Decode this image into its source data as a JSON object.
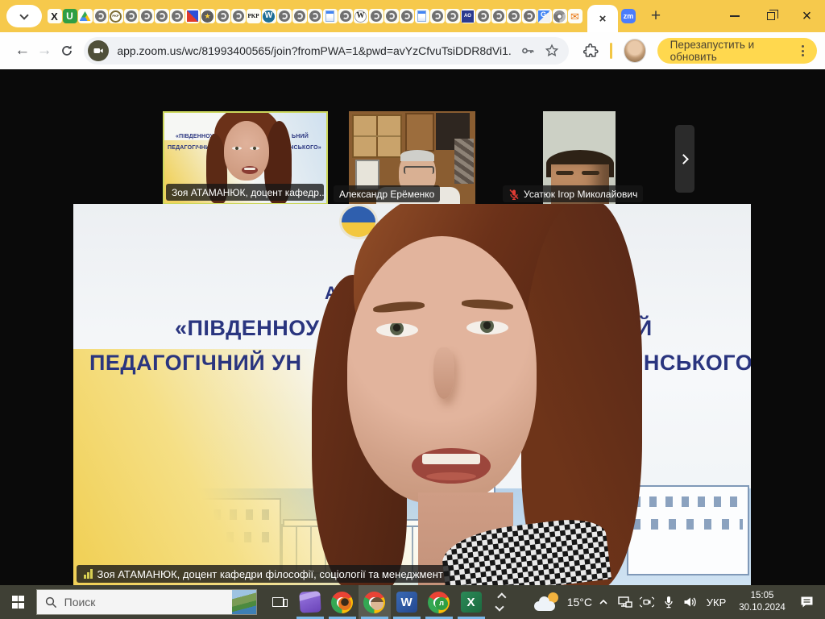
{
  "browser": {
    "tab_strip": {
      "tabs": [
        "joomla",
        "u",
        "drive",
        "spin",
        "pkp-round",
        "spin",
        "spin",
        "spin",
        "spin",
        "flag",
        "star",
        "spin",
        "spin",
        "pkp",
        "wordpress",
        "spin",
        "spin",
        "spin",
        "doc",
        "spin",
        "wiki",
        "spin",
        "spin",
        "spin",
        "doc",
        "spin",
        "spin",
        "ao",
        "spin",
        "spin",
        "spin",
        "spin",
        "translate",
        "chrome-gray",
        "mail"
      ],
      "active_tab_close": "×",
      "new_tab_glyph": "+"
    },
    "window_controls": {
      "close": "×"
    },
    "nav": {
      "back": "←",
      "forward": "→"
    },
    "address": {
      "url": "app.zoom.us/wc/81993400565/join?fromPWA=1&pwd=avYzCfvuTsiDDR8dVi1..."
    },
    "update_button": {
      "label": "Перезапустить и обновить"
    }
  },
  "icon_glyphs": {
    "joomla": "X",
    "u": "U",
    "pkp-round": "PKP",
    "star": "★",
    "pkp": "PKP",
    "wordpress": "W",
    "wiki": "W",
    "ao": "АО",
    "translate": "G",
    "mail": "✉",
    "zm": "zm",
    "word": "W",
    "excel": "X"
  },
  "meeting": {
    "banner": {
      "partial_top": "А",
      "l1_left": "«ПІВДЕННОУ",
      "l1_right": "ЬНИЙ",
      "l2_left": "ПЕДАГОГІЧНИЙ УН",
      "l2_right": "ИНСЬКОГО»"
    },
    "participants": [
      {
        "name": "Зоя АТАМАНЮК, доцент кафедр..."
      },
      {
        "name": "Александр Ерёменко"
      },
      {
        "name": "Усатюк Ігор Миколайович"
      }
    ],
    "main_speaker_label": "Зоя АТАМАНЮК, доцент кафедри філософії, соціології та менеджмент"
  },
  "taskbar": {
    "search_placeholder": "Поиск",
    "apps": [
      {
        "icon": "taskview",
        "active": false
      },
      {
        "icon": "movies",
        "active": true
      },
      {
        "icon": "chrome",
        "badge": "orange",
        "active": true
      },
      {
        "icon": "chrome",
        "badge": "photo",
        "active": true,
        "focused": true
      },
      {
        "icon": "word",
        "active": true
      },
      {
        "icon": "chrome",
        "badge": "letter",
        "badge_glyph": "л",
        "active": true
      },
      {
        "icon": "excel",
        "active": true
      }
    ],
    "weather": "15°C",
    "language": "УКР",
    "time": "15:05",
    "date": "30.10.2024"
  },
  "colors": {
    "accent_yellow": "#f6c94c",
    "update_button_yellow": "#ffd84e",
    "active_speaker_border": "#ccd75c",
    "taskbar_underline": "#79b8eb",
    "banner_blue": "#2a357f"
  }
}
